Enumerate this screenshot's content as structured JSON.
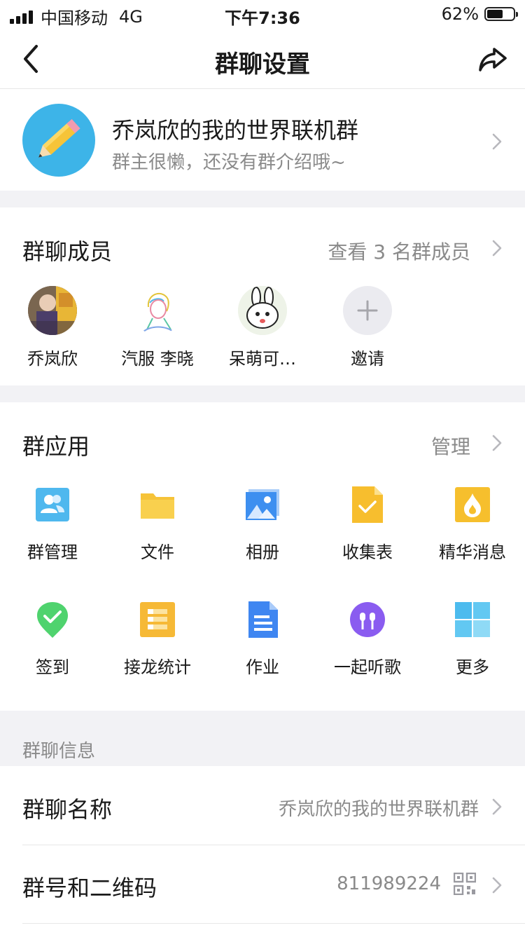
{
  "status_bar": {
    "carrier": "中国移动",
    "network": "4G",
    "time": "下午7:36",
    "battery": "62%",
    "battery_level": 0.62
  },
  "nav": {
    "title": "群聊设置",
    "back_icon": "chevron-left-icon",
    "share_icon": "share-icon"
  },
  "group": {
    "name": "乔岚欣的我的世界联机群",
    "description": "群主很懒，还没有群介绍哦~",
    "avatar_icon": "pencil-icon",
    "avatar_color": "#3db4e8"
  },
  "members": {
    "title": "群聊成员",
    "view_all": "查看 3 名群成员",
    "list": [
      {
        "name": "乔岚欣",
        "avatar": "photo-avatar"
      },
      {
        "name": "汽服 李晓",
        "avatar": "sketch-avatar"
      },
      {
        "name": "呆萌可…",
        "avatar": "rabbit-avatar"
      },
      {
        "name": "邀请",
        "avatar": "plus-icon"
      }
    ]
  },
  "apps": {
    "title": "群应用",
    "manage": "管理",
    "items": [
      {
        "label": "群管理",
        "icon": "group-manage-icon",
        "color": "#4fb8ee"
      },
      {
        "label": "文件",
        "icon": "folder-icon",
        "color": "#f6c338"
      },
      {
        "label": "相册",
        "icon": "album-icon",
        "color": "#3d8ff0"
      },
      {
        "label": "收集表",
        "icon": "form-icon",
        "color": "#f7be2e"
      },
      {
        "label": "精华消息",
        "icon": "essence-icon",
        "color": "#f6bf2d"
      },
      {
        "label": "签到",
        "icon": "check-in-icon",
        "color": "#4fd36e"
      },
      {
        "label": "接龙统计",
        "icon": "list-icon",
        "color": "#f6b936"
      },
      {
        "label": "作业",
        "icon": "document-icon",
        "color": "#3f86f1"
      },
      {
        "label": "一起听歌",
        "icon": "earphones-icon",
        "color": "#8a5cf0"
      },
      {
        "label": "更多",
        "icon": "grid-icon",
        "color": "#4cbbee"
      }
    ]
  },
  "info": {
    "section_label": "群聊信息",
    "rows": [
      {
        "title": "群聊名称",
        "value": "乔岚欣的我的世界联机群"
      },
      {
        "title": "群号和二维码",
        "value": "811989224",
        "icon": "qr-code-icon"
      }
    ]
  },
  "colors": {
    "background": "#ffffff",
    "section_gap": "#f2f2f5",
    "secondary_text": "#8a8a8a",
    "chevron": "#b8b8bd"
  }
}
